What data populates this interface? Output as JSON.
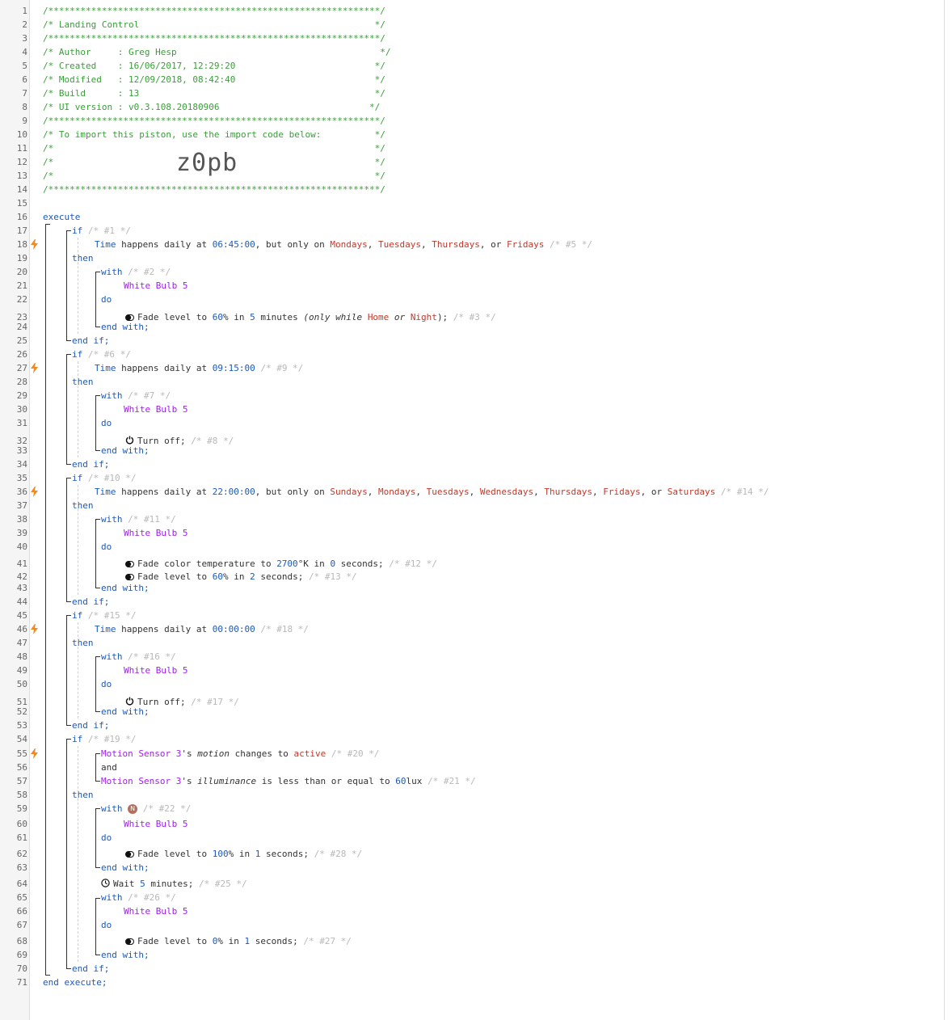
{
  "header": {
    "border": "/**************************************************************/",
    "title": "/* Landing Control                                            */",
    "author": "/* Author     : Greg Hesp                                      */",
    "created": "/* Created    : 16/06/2017, 12:29:20                          */",
    "modified": "/* Modified   : 12/09/2018, 08:42:40                          */",
    "build": "/* Build      : 13                                            */",
    "ui_version": "/* UI version : v0.3.108.20180906                            */",
    "import_note": "/* To import this piston, use the import code below:          */",
    "blank_a": "/*                                                            */",
    "blank_b": "/*                                                            */",
    "blank_c": "/*                                                            */",
    "import_code": "z0pb"
  },
  "lines": {
    "l16": "execute",
    "l71": "end execute;"
  },
  "blocks": [
    {
      "if_comment": "/* #1 */",
      "cond": [
        {
          "t": "Time",
          "c": "at"
        },
        {
          "t": " happens daily at ",
          "c": "tx"
        },
        {
          "t": "06:45:00",
          "c": "num"
        },
        {
          "t": ", but only on ",
          "c": "tx"
        },
        {
          "t": "Mondays",
          "c": "rd"
        },
        {
          "t": ", ",
          "c": "tx"
        },
        {
          "t": "Tuesdays",
          "c": "rd"
        },
        {
          "t": ", ",
          "c": "tx"
        },
        {
          "t": "Thursdays",
          "c": "rd"
        },
        {
          "t": ", or ",
          "c": "tx"
        },
        {
          "t": "Fridays",
          "c": "rd"
        },
        {
          "t": " /* #5 */",
          "c": "cm"
        }
      ],
      "with_comment": "/* #2 */",
      "device": "White Bulb 5",
      "tasks": [
        [
          {
            "t": "Fade level to ",
            "c": "tx"
          },
          {
            "t": "60",
            "c": "num"
          },
          {
            "t": "% in ",
            "c": "tx"
          },
          {
            "t": "5",
            "c": "num"
          },
          {
            "t": " minutes ",
            "c": "tx"
          },
          {
            "t": "(only while ",
            "c": "it"
          },
          {
            "t": "Home",
            "c": "rd"
          },
          {
            "t": " or ",
            "c": "it"
          },
          {
            "t": "Night",
            "c": "rd"
          },
          {
            "t": ");",
            "c": "tx"
          },
          {
            "t": " /* #3 */",
            "c": "cm"
          }
        ]
      ]
    },
    {
      "if_comment": "/* #6 */",
      "cond": [
        {
          "t": "Time",
          "c": "at"
        },
        {
          "t": " happens daily at ",
          "c": "tx"
        },
        {
          "t": "09:15:00",
          "c": "num"
        },
        {
          "t": " /* #9 */",
          "c": "cm"
        }
      ],
      "with_comment": "/* #7 */",
      "device": "White Bulb 5",
      "tasks": [
        [
          {
            "t": "Turn off;",
            "c": "tx"
          },
          {
            "t": " /* #8 */",
            "c": "cm"
          }
        ]
      ]
    },
    {
      "if_comment": "/* #10 */",
      "cond": [
        {
          "t": "Time",
          "c": "at"
        },
        {
          "t": " happens daily at ",
          "c": "tx"
        },
        {
          "t": "22:00:00",
          "c": "num"
        },
        {
          "t": ", but only on ",
          "c": "tx"
        },
        {
          "t": "Sundays",
          "c": "rd"
        },
        {
          "t": ", ",
          "c": "tx"
        },
        {
          "t": "Mondays",
          "c": "rd"
        },
        {
          "t": ", ",
          "c": "tx"
        },
        {
          "t": "Tuesdays",
          "c": "rd"
        },
        {
          "t": ", ",
          "c": "tx"
        },
        {
          "t": "Wednesdays",
          "c": "rd"
        },
        {
          "t": ", ",
          "c": "tx"
        },
        {
          "t": "Thursdays",
          "c": "rd"
        },
        {
          "t": ", ",
          "c": "tx"
        },
        {
          "t": "Fridays",
          "c": "rd"
        },
        {
          "t": ", or ",
          "c": "tx"
        },
        {
          "t": "Saturdays",
          "c": "rd"
        },
        {
          "t": " /* #14 */",
          "c": "cm"
        }
      ],
      "with_comment": "/* #11 */",
      "device": "White Bulb 5",
      "tasks": [
        [
          {
            "t": "Fade color temperature to ",
            "c": "tx"
          },
          {
            "t": "2700",
            "c": "num"
          },
          {
            "t": "°K in ",
            "c": "tx"
          },
          {
            "t": "0",
            "c": "num"
          },
          {
            "t": " seconds;",
            "c": "tx"
          },
          {
            "t": " /* #12 */",
            "c": "cm"
          }
        ],
        [
          {
            "t": "Fade level to ",
            "c": "tx"
          },
          {
            "t": "60",
            "c": "num"
          },
          {
            "t": "% in ",
            "c": "tx"
          },
          {
            "t": "2",
            "c": "num"
          },
          {
            "t": " seconds;",
            "c": "tx"
          },
          {
            "t": " /* #13 */",
            "c": "cm"
          }
        ]
      ]
    },
    {
      "if_comment": "/* #15 */",
      "cond": [
        {
          "t": "Time",
          "c": "at"
        },
        {
          "t": " happens daily at ",
          "c": "tx"
        },
        {
          "t": "00:00:00",
          "c": "num"
        },
        {
          "t": " /* #18 */",
          "c": "cm"
        }
      ],
      "with_comment": "/* #16 */",
      "device": "White Bulb 5",
      "tasks": [
        [
          {
            "t": "Turn off;",
            "c": "tx"
          },
          {
            "t": " /* #17 */",
            "c": "cm"
          }
        ]
      ]
    },
    {
      "if_comment": "/* #19 */",
      "cond1": [
        {
          "t": "Motion Sensor 3",
          "c": "dv"
        },
        {
          "t": "'s ",
          "c": "tx"
        },
        {
          "t": "motion",
          "c": "it"
        },
        {
          "t": " changes to ",
          "c": "tx"
        },
        {
          "t": "active",
          "c": "rd"
        },
        {
          "t": " /* #20 */",
          "c": "cm"
        }
      ],
      "and": "and",
      "cond2": [
        {
          "t": "Motion Sensor 3",
          "c": "dv"
        },
        {
          "t": "'s ",
          "c": "tx"
        },
        {
          "t": "illuminance",
          "c": "it"
        },
        {
          "t": " is less than or equal to ",
          "c": "tx"
        },
        {
          "t": "60",
          "c": "num"
        },
        {
          "t": "lux",
          "c": "tx"
        },
        {
          "t": " /* #21 */",
          "c": "cm"
        }
      ],
      "with1_comment": "/* #22 */",
      "with1_badge": "N",
      "device": "White Bulb 5",
      "task1": [
        {
          "t": "Fade level to ",
          "c": "tx"
        },
        {
          "t": "100",
          "c": "num"
        },
        {
          "t": "% in ",
          "c": "tx"
        },
        {
          "t": "1",
          "c": "num"
        },
        {
          "t": " seconds;",
          "c": "tx"
        },
        {
          "t": " /* #28 */",
          "c": "cm"
        }
      ],
      "wait": [
        {
          "t": "Wait ",
          "c": "tx"
        },
        {
          "t": "5",
          "c": "num"
        },
        {
          "t": " minutes;",
          "c": "tx"
        },
        {
          "t": " /* #25 */",
          "c": "cm"
        }
      ],
      "with2_comment": "/* #26 */",
      "task2": [
        {
          "t": "Fade level to ",
          "c": "tx"
        },
        {
          "t": "0",
          "c": "num"
        },
        {
          "t": "% in ",
          "c": "tx"
        },
        {
          "t": "1",
          "c": "num"
        },
        {
          "t": " seconds;",
          "c": "tx"
        },
        {
          "t": " /* #27 */",
          "c": "cm"
        }
      ]
    }
  ],
  "keywords": {
    "if": "if",
    "then": "then",
    "with": "with",
    "do": "do",
    "end_with": "end with;",
    "end_if": "end if;"
  },
  "line_count": 71,
  "bolt_lines": [
    18,
    27,
    36,
    46,
    55
  ],
  "colors": {
    "bolt": "#f08a24",
    "comment_green": "#3a9d3a",
    "keyword": "#1e59b8",
    "device": "#a020f0",
    "value_red": "#c0392b"
  }
}
